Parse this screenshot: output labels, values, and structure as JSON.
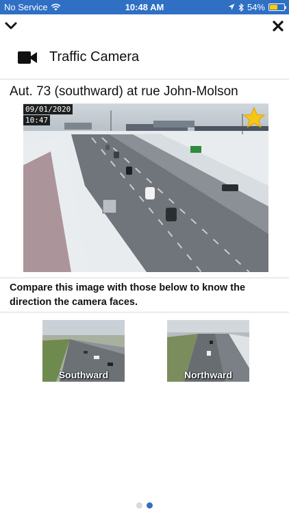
{
  "status_bar": {
    "carrier": "No Service",
    "time": "10:48 AM",
    "battery_percent": "54%",
    "battery_level": 0.54,
    "icons": [
      "wifi-icon",
      "location-arrow-icon",
      "bluetooth-icon",
      "battery-icon"
    ]
  },
  "nav": {
    "collapse_icon": "chevron-down-icon",
    "close_icon": "close-icon"
  },
  "header": {
    "icon": "video-camera-icon",
    "title": "Traffic Camera"
  },
  "camera": {
    "name": "Aut. 73 (southward) at rue John-Molson",
    "date": "09/01/2020",
    "time": "10:47",
    "favorite_icon": "star-icon",
    "favorite_color": "#f5c518"
  },
  "compare": {
    "text": "Compare this image with those below to know the direction the camera faces."
  },
  "directions": [
    {
      "label": "Southward"
    },
    {
      "label": "Northward"
    }
  ],
  "pagination": {
    "pages": 2,
    "active_index": 1,
    "active_color": "#2f6fc4",
    "inactive_color": "#d9d9d9"
  },
  "colors": {
    "status_bar": "#2f6fc4",
    "divider": "#d9d9d9"
  }
}
